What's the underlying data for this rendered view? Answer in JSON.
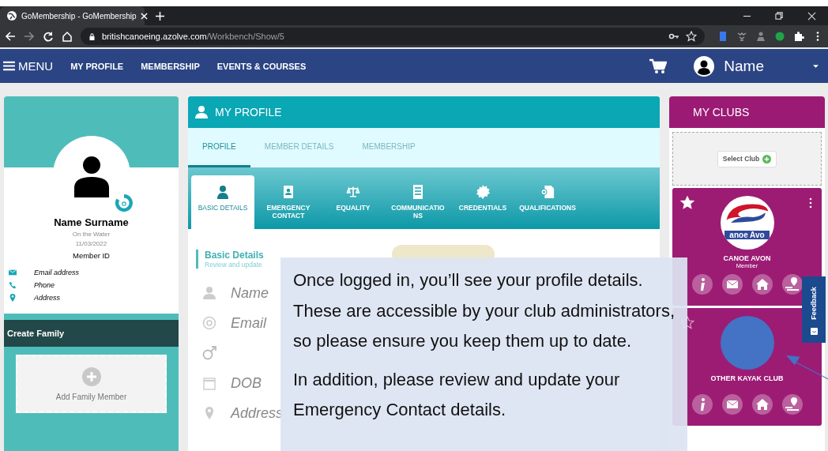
{
  "browser": {
    "tab_title": "GoMembership - GoMembership",
    "url_host": "britishcanoeing.azolve.com",
    "url_path": "/Workbench/Show/5"
  },
  "nav": {
    "menu_label": "MENU",
    "items": [
      "MY PROFILE",
      "MEMBERSHIP",
      "EVENTS & COURSES"
    ],
    "user_name": "Name"
  },
  "member_card": {
    "name": "Name Surname",
    "discipline": "On the Water",
    "date": "11/03/2022",
    "member_id": "Member ID",
    "contacts": [
      {
        "kind": "email",
        "text": "Email address"
      },
      {
        "kind": "phone",
        "text": "Phone"
      },
      {
        "kind": "address",
        "text": "Address"
      }
    ],
    "family_title": "Create Family",
    "add_family": "Add Family Member"
  },
  "profile": {
    "title": "MY PROFILE",
    "tabs": [
      {
        "label": "PROFILE",
        "selected": true
      },
      {
        "label": "MEMBER DETAILS",
        "selected": false
      },
      {
        "label": "MEMBERSHIP",
        "selected": false
      }
    ],
    "subtabs": [
      {
        "kind": "person",
        "label": "BASIC DETAILS",
        "selected": true
      },
      {
        "kind": "contact",
        "label": "EMERGENCY CONTACT",
        "selected": false
      },
      {
        "kind": "scales",
        "label": "EQUALITY",
        "selected": false
      },
      {
        "kind": "list",
        "label": "COMMUNICATIO NS",
        "selected": false
      },
      {
        "kind": "badge",
        "label": "CREDENTIALS",
        "selected": false
      },
      {
        "kind": "certificate",
        "label": "QUALIFICATIONS",
        "selected": false
      }
    ],
    "section_title": "Basic Details",
    "section_subtitle": "Review and update",
    "fields": [
      {
        "kind": "name",
        "value": "Name"
      },
      {
        "kind": "email",
        "value": "Email"
      },
      {
        "kind": "gender"
      },
      {
        "kind": "dob",
        "value": "DOB"
      },
      {
        "kind": "address",
        "value": "Address"
      }
    ]
  },
  "clubs": {
    "title": "MY CLUBS",
    "select_label": "Select Club",
    "items": [
      {
        "name": "CANOE AVON",
        "role": "Member",
        "favorite": true,
        "logo_text": "anoe Avo"
      },
      {
        "name": "OTHER KAYAK CLUB",
        "favorite": false
      }
    ]
  },
  "feedback": "Feedback",
  "callout": {
    "paragraphs": [
      "Once logged in, you’ll see your profile details.  These are accessible by your club administrators, so please ensure you keep them up to date.",
      "In addition, please review and update your Emergency Contact details."
    ]
  }
}
